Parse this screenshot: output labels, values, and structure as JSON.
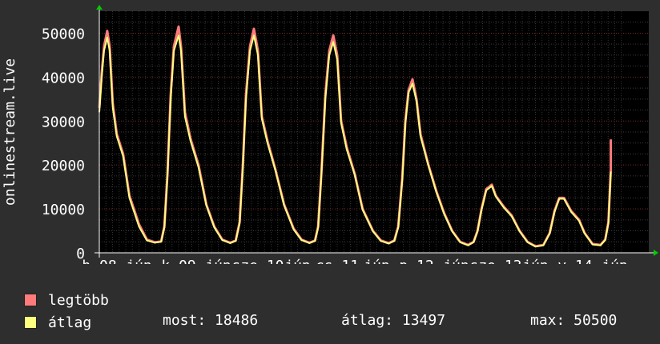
{
  "chart_data": {
    "type": "area",
    "ylabel": "onlinestream.live",
    "ylim": [
      0,
      55000
    ],
    "yticks": [
      0,
      10000,
      20000,
      30000,
      40000,
      50000
    ],
    "xticks": [
      "h 08",
      "jún",
      "k 09",
      "jún",
      "sze 10",
      "jún",
      "cs 11",
      "jún",
      "p 12",
      "jún",
      "szo 13",
      "jún",
      "v 14",
      "jún"
    ],
    "xlim": [
      0,
      6.6
    ],
    "grid": true,
    "series": [
      {
        "name": "legtöbb",
        "color": "#ff7b7b",
        "points": [
          [
            0,
            33000
          ],
          [
            0.03,
            41000
          ],
          [
            0.06,
            47000
          ],
          [
            0.1,
            50500
          ],
          [
            0.13,
            47000
          ],
          [
            0.17,
            34000
          ],
          [
            0.22,
            27000
          ],
          [
            0.3,
            22500
          ],
          [
            0.38,
            13000
          ],
          [
            0.5,
            6500
          ],
          [
            0.6,
            3000
          ],
          [
            0.7,
            2400
          ],
          [
            0.78,
            2600
          ],
          [
            0.82,
            6000
          ],
          [
            0.86,
            18000
          ],
          [
            0.9,
            36000
          ],
          [
            0.94,
            47000
          ],
          [
            1.0,
            51500
          ],
          [
            1.03,
            47000
          ],
          [
            1.08,
            32000
          ],
          [
            1.15,
            26000
          ],
          [
            1.25,
            20000
          ],
          [
            1.35,
            11000
          ],
          [
            1.45,
            6000
          ],
          [
            1.55,
            3000
          ],
          [
            1.65,
            2300
          ],
          [
            1.72,
            2800
          ],
          [
            1.77,
            7000
          ],
          [
            1.81,
            20000
          ],
          [
            1.85,
            36000
          ],
          [
            1.9,
            47000
          ],
          [
            1.95,
            51000
          ],
          [
            2.0,
            46000
          ],
          [
            2.05,
            31000
          ],
          [
            2.12,
            25500
          ],
          [
            2.22,
            19000
          ],
          [
            2.33,
            11000
          ],
          [
            2.45,
            5500
          ],
          [
            2.55,
            3000
          ],
          [
            2.65,
            2300
          ],
          [
            2.72,
            2800
          ],
          [
            2.76,
            6000
          ],
          [
            2.8,
            18000
          ],
          [
            2.85,
            36000
          ],
          [
            2.9,
            46000
          ],
          [
            2.95,
            49500
          ],
          [
            3.0,
            45000
          ],
          [
            3.05,
            30000
          ],
          [
            3.12,
            24000
          ],
          [
            3.22,
            18000
          ],
          [
            3.32,
            10000
          ],
          [
            3.45,
            5000
          ],
          [
            3.55,
            2800
          ],
          [
            3.65,
            2200
          ],
          [
            3.72,
            2800
          ],
          [
            3.77,
            6000
          ],
          [
            3.82,
            17000
          ],
          [
            3.86,
            30000
          ],
          [
            3.9,
            37000
          ],
          [
            3.95,
            39500
          ],
          [
            4.0,
            35000
          ],
          [
            4.05,
            27000
          ],
          [
            4.15,
            20000
          ],
          [
            4.25,
            14000
          ],
          [
            4.35,
            9000
          ],
          [
            4.45,
            5000
          ],
          [
            4.55,
            2500
          ],
          [
            4.65,
            1800
          ],
          [
            4.72,
            2500
          ],
          [
            4.77,
            5000
          ],
          [
            4.82,
            10000
          ],
          [
            4.88,
            14500
          ],
          [
            4.95,
            15500
          ],
          [
            5.0,
            13000
          ],
          [
            5.1,
            10500
          ],
          [
            5.2,
            8500
          ],
          [
            5.3,
            5000
          ],
          [
            5.4,
            2500
          ],
          [
            5.5,
            1500
          ],
          [
            5.6,
            1800
          ],
          [
            5.68,
            4500
          ],
          [
            5.74,
            9500
          ],
          [
            5.8,
            12500
          ],
          [
            5.86,
            12500
          ],
          [
            5.95,
            9500
          ],
          [
            6.05,
            7500
          ],
          [
            6.12,
            4500
          ],
          [
            6.22,
            2000
          ],
          [
            6.32,
            1800
          ],
          [
            6.38,
            3000
          ],
          [
            6.42,
            7000
          ],
          [
            6.45,
            19000
          ],
          [
            6.45,
            25800
          ]
        ]
      },
      {
        "name": "átlag",
        "color": "#ffff80",
        "points": [
          [
            0,
            32000
          ],
          [
            0.03,
            40000
          ],
          [
            0.06,
            46000
          ],
          [
            0.1,
            49000
          ],
          [
            0.13,
            46000
          ],
          [
            0.17,
            33000
          ],
          [
            0.22,
            26500
          ],
          [
            0.3,
            22000
          ],
          [
            0.38,
            12500
          ],
          [
            0.5,
            6000
          ],
          [
            0.6,
            2800
          ],
          [
            0.7,
            2300
          ],
          [
            0.78,
            2500
          ],
          [
            0.82,
            5800
          ],
          [
            0.86,
            17500
          ],
          [
            0.9,
            35000
          ],
          [
            0.94,
            46000
          ],
          [
            1.0,
            49500
          ],
          [
            1.03,
            46000
          ],
          [
            1.08,
            31000
          ],
          [
            1.15,
            25500
          ],
          [
            1.25,
            19500
          ],
          [
            1.35,
            10800
          ],
          [
            1.45,
            5800
          ],
          [
            1.55,
            2900
          ],
          [
            1.65,
            2200
          ],
          [
            1.72,
            2700
          ],
          [
            1.77,
            6800
          ],
          [
            1.81,
            19500
          ],
          [
            1.85,
            35000
          ],
          [
            1.9,
            46000
          ],
          [
            1.95,
            49500
          ],
          [
            2.0,
            45000
          ],
          [
            2.05,
            30500
          ],
          [
            2.12,
            25000
          ],
          [
            2.22,
            18800
          ],
          [
            2.33,
            10800
          ],
          [
            2.45,
            5300
          ],
          [
            2.55,
            2900
          ],
          [
            2.65,
            2200
          ],
          [
            2.72,
            2700
          ],
          [
            2.76,
            5800
          ],
          [
            2.8,
            17500
          ],
          [
            2.85,
            35000
          ],
          [
            2.9,
            45000
          ],
          [
            2.95,
            48000
          ],
          [
            3.0,
            44000
          ],
          [
            3.05,
            29500
          ],
          [
            3.12,
            23500
          ],
          [
            3.22,
            17800
          ],
          [
            3.32,
            9800
          ],
          [
            3.45,
            4900
          ],
          [
            3.55,
            2700
          ],
          [
            3.65,
            2100
          ],
          [
            3.72,
            2700
          ],
          [
            3.77,
            5800
          ],
          [
            3.82,
            16500
          ],
          [
            3.86,
            29500
          ],
          [
            3.9,
            36500
          ],
          [
            3.95,
            38500
          ],
          [
            4.0,
            34500
          ],
          [
            4.05,
            26500
          ],
          [
            4.15,
            19800
          ],
          [
            4.25,
            13800
          ],
          [
            4.35,
            8800
          ],
          [
            4.45,
            4900
          ],
          [
            4.55,
            2400
          ],
          [
            4.65,
            1700
          ],
          [
            4.72,
            2400
          ],
          [
            4.77,
            4900
          ],
          [
            4.82,
            9800
          ],
          [
            4.88,
            14200
          ],
          [
            4.95,
            15200
          ],
          [
            5.0,
            12800
          ],
          [
            5.1,
            10300
          ],
          [
            5.2,
            8300
          ],
          [
            5.3,
            4900
          ],
          [
            5.4,
            2400
          ],
          [
            5.5,
            1400
          ],
          [
            5.6,
            1700
          ],
          [
            5.68,
            4400
          ],
          [
            5.74,
            9300
          ],
          [
            5.8,
            12300
          ],
          [
            5.86,
            12300
          ],
          [
            5.95,
            9300
          ],
          [
            6.05,
            7300
          ],
          [
            6.12,
            4400
          ],
          [
            6.22,
            1900
          ],
          [
            6.32,
            1700
          ],
          [
            6.38,
            2900
          ],
          [
            6.42,
            6800
          ],
          [
            6.45,
            18486
          ]
        ]
      }
    ]
  },
  "legend": {
    "max_label": "legtöbb",
    "avg_label": "átlag",
    "max_color": "#ff7b7b",
    "avg_color": "#ffff80"
  },
  "stats": {
    "current": "most: 18486",
    "average": "átlag: 13497",
    "maximum": "max: 50500"
  }
}
